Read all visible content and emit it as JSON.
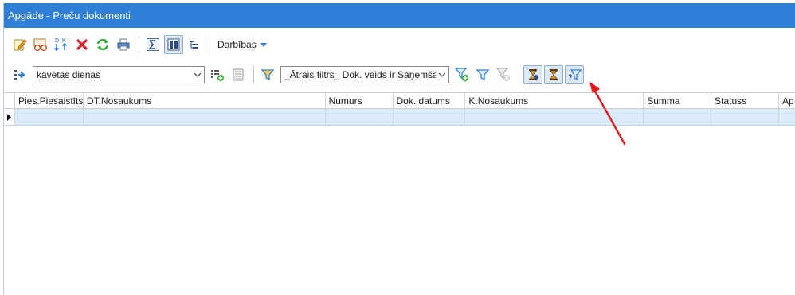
{
  "window": {
    "title": "Apgāde - Preču dokumenti"
  },
  "toolbar1": {
    "actions_label": "Darbības",
    "icons": [
      "edit-icon",
      "view-icon",
      "debit-credit-icon",
      "delete-icon",
      "refresh-icon",
      "print-icon",
      "sum-icon",
      "columns-icon",
      "tree-icon"
    ]
  },
  "toolbar2": {
    "filter_combo_value": "kavētās dienas",
    "quick_filter_value": "_Ātrais filtrs_ Dok. veids ir Saņemšan"
  },
  "grid": {
    "columns": [
      {
        "label": "Pies.Piesaistīts"
      },
      {
        "label": "DT.Nosaukums"
      },
      {
        "label": "Numurs"
      },
      {
        "label": "Dok. datums"
      },
      {
        "label": "K.Nosaukums"
      },
      {
        "label": "Summa"
      },
      {
        "label": "Statuss"
      },
      {
        "label": "Ap"
      }
    ],
    "rows": [
      [
        "",
        "",
        "",
        "",
        "",
        "",
        "",
        ""
      ]
    ]
  },
  "colors": {
    "title_bar": "#2e7fd6",
    "selected_row": "#dcebfa",
    "annotation_arrow": "#e31b1b"
  }
}
